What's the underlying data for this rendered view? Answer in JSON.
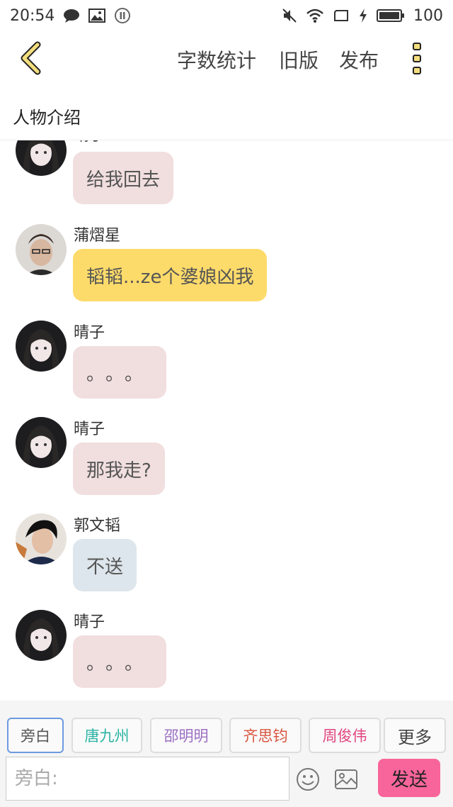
{
  "status_bar": {
    "time": "20:54",
    "battery": "100"
  },
  "toolbar": {
    "word_count": "字数统计",
    "old_version": "旧版",
    "publish": "发布"
  },
  "section_title": "人物介绍",
  "messages": [
    {
      "name": "晴子",
      "text": "给我回去",
      "bubble_color": "#f1dede"
    },
    {
      "name": "蒲熠星",
      "text": "韬韬...ze个婆娘凶我",
      "bubble_color": "#fddb6a"
    },
    {
      "name": "晴子",
      "text": "。。。",
      "bubble_color": "#f1dede"
    },
    {
      "name": "晴子",
      "text": "那我走?",
      "bubble_color": "#f1dede"
    },
    {
      "name": "郭文韬",
      "text": "不送",
      "bubble_color": "#dde6ec"
    },
    {
      "name": "晴子",
      "text": "。。。",
      "bubble_color": "#f1dede"
    }
  ],
  "roles": [
    {
      "label": "旁白",
      "color": "#555555",
      "selected": true
    },
    {
      "label": "唐九州",
      "color": "#2bb3a3"
    },
    {
      "label": "邵明明",
      "color": "#9b6fc3"
    },
    {
      "label": "齐思钧",
      "color": "#d9553e"
    },
    {
      "label": "周俊伟",
      "color": "#e0457e"
    },
    {
      "label": "更多",
      "color": "#444444"
    }
  ],
  "input": {
    "placeholder": "旁白:"
  },
  "send_label": "发送",
  "icons": {
    "back": "chevron-left-icon",
    "menu": "more-vertical-icon",
    "emoji": "emoji-icon",
    "image": "image-icon"
  }
}
